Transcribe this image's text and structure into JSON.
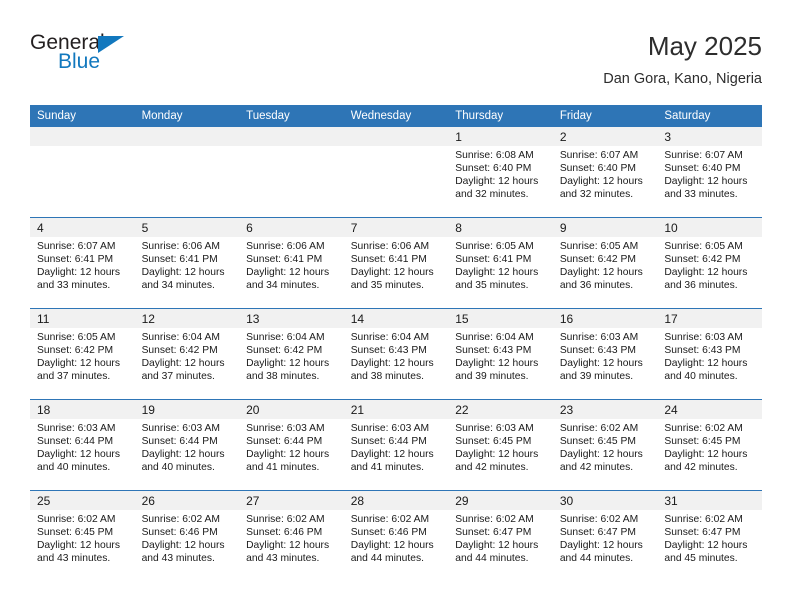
{
  "brand": {
    "name_part1": "General",
    "name_part2": "Blue",
    "triangle_color": "#1278be"
  },
  "header": {
    "title": "May 2025",
    "subtitle": "Dan Gora, Kano, Nigeria"
  },
  "theme": {
    "header_blue": "#2e75b6",
    "daynum_gray": "#f1f1f1",
    "text": "#1a1a1a"
  },
  "weekdays": [
    "Sunday",
    "Monday",
    "Tuesday",
    "Wednesday",
    "Thursday",
    "Friday",
    "Saturday"
  ],
  "weeks": [
    [
      {
        "day": "",
        "lines": []
      },
      {
        "day": "",
        "lines": []
      },
      {
        "day": "",
        "lines": []
      },
      {
        "day": "",
        "lines": []
      },
      {
        "day": "1",
        "lines": [
          "Sunrise: 6:08 AM",
          "Sunset: 6:40 PM",
          "Daylight: 12 hours",
          "and 32 minutes."
        ]
      },
      {
        "day": "2",
        "lines": [
          "Sunrise: 6:07 AM",
          "Sunset: 6:40 PM",
          "Daylight: 12 hours",
          "and 32 minutes."
        ]
      },
      {
        "day": "3",
        "lines": [
          "Sunrise: 6:07 AM",
          "Sunset: 6:40 PM",
          "Daylight: 12 hours",
          "and 33 minutes."
        ]
      }
    ],
    [
      {
        "day": "4",
        "lines": [
          "Sunrise: 6:07 AM",
          "Sunset: 6:41 PM",
          "Daylight: 12 hours",
          "and 33 minutes."
        ]
      },
      {
        "day": "5",
        "lines": [
          "Sunrise: 6:06 AM",
          "Sunset: 6:41 PM",
          "Daylight: 12 hours",
          "and 34 minutes."
        ]
      },
      {
        "day": "6",
        "lines": [
          "Sunrise: 6:06 AM",
          "Sunset: 6:41 PM",
          "Daylight: 12 hours",
          "and 34 minutes."
        ]
      },
      {
        "day": "7",
        "lines": [
          "Sunrise: 6:06 AM",
          "Sunset: 6:41 PM",
          "Daylight: 12 hours",
          "and 35 minutes."
        ]
      },
      {
        "day": "8",
        "lines": [
          "Sunrise: 6:05 AM",
          "Sunset: 6:41 PM",
          "Daylight: 12 hours",
          "and 35 minutes."
        ]
      },
      {
        "day": "9",
        "lines": [
          "Sunrise: 6:05 AM",
          "Sunset: 6:42 PM",
          "Daylight: 12 hours",
          "and 36 minutes."
        ]
      },
      {
        "day": "10",
        "lines": [
          "Sunrise: 6:05 AM",
          "Sunset: 6:42 PM",
          "Daylight: 12 hours",
          "and 36 minutes."
        ]
      }
    ],
    [
      {
        "day": "11",
        "lines": [
          "Sunrise: 6:05 AM",
          "Sunset: 6:42 PM",
          "Daylight: 12 hours",
          "and 37 minutes."
        ]
      },
      {
        "day": "12",
        "lines": [
          "Sunrise: 6:04 AM",
          "Sunset: 6:42 PM",
          "Daylight: 12 hours",
          "and 37 minutes."
        ]
      },
      {
        "day": "13",
        "lines": [
          "Sunrise: 6:04 AM",
          "Sunset: 6:42 PM",
          "Daylight: 12 hours",
          "and 38 minutes."
        ]
      },
      {
        "day": "14",
        "lines": [
          "Sunrise: 6:04 AM",
          "Sunset: 6:43 PM",
          "Daylight: 12 hours",
          "and 38 minutes."
        ]
      },
      {
        "day": "15",
        "lines": [
          "Sunrise: 6:04 AM",
          "Sunset: 6:43 PM",
          "Daylight: 12 hours",
          "and 39 minutes."
        ]
      },
      {
        "day": "16",
        "lines": [
          "Sunrise: 6:03 AM",
          "Sunset: 6:43 PM",
          "Daylight: 12 hours",
          "and 39 minutes."
        ]
      },
      {
        "day": "17",
        "lines": [
          "Sunrise: 6:03 AM",
          "Sunset: 6:43 PM",
          "Daylight: 12 hours",
          "and 40 minutes."
        ]
      }
    ],
    [
      {
        "day": "18",
        "lines": [
          "Sunrise: 6:03 AM",
          "Sunset: 6:44 PM",
          "Daylight: 12 hours",
          "and 40 minutes."
        ]
      },
      {
        "day": "19",
        "lines": [
          "Sunrise: 6:03 AM",
          "Sunset: 6:44 PM",
          "Daylight: 12 hours",
          "and 40 minutes."
        ]
      },
      {
        "day": "20",
        "lines": [
          "Sunrise: 6:03 AM",
          "Sunset: 6:44 PM",
          "Daylight: 12 hours",
          "and 41 minutes."
        ]
      },
      {
        "day": "21",
        "lines": [
          "Sunrise: 6:03 AM",
          "Sunset: 6:44 PM",
          "Daylight: 12 hours",
          "and 41 minutes."
        ]
      },
      {
        "day": "22",
        "lines": [
          "Sunrise: 6:03 AM",
          "Sunset: 6:45 PM",
          "Daylight: 12 hours",
          "and 42 minutes."
        ]
      },
      {
        "day": "23",
        "lines": [
          "Sunrise: 6:02 AM",
          "Sunset: 6:45 PM",
          "Daylight: 12 hours",
          "and 42 minutes."
        ]
      },
      {
        "day": "24",
        "lines": [
          "Sunrise: 6:02 AM",
          "Sunset: 6:45 PM",
          "Daylight: 12 hours",
          "and 42 minutes."
        ]
      }
    ],
    [
      {
        "day": "25",
        "lines": [
          "Sunrise: 6:02 AM",
          "Sunset: 6:45 PM",
          "Daylight: 12 hours",
          "and 43 minutes."
        ]
      },
      {
        "day": "26",
        "lines": [
          "Sunrise: 6:02 AM",
          "Sunset: 6:46 PM",
          "Daylight: 12 hours",
          "and 43 minutes."
        ]
      },
      {
        "day": "27",
        "lines": [
          "Sunrise: 6:02 AM",
          "Sunset: 6:46 PM",
          "Daylight: 12 hours",
          "and 43 minutes."
        ]
      },
      {
        "day": "28",
        "lines": [
          "Sunrise: 6:02 AM",
          "Sunset: 6:46 PM",
          "Daylight: 12 hours",
          "and 44 minutes."
        ]
      },
      {
        "day": "29",
        "lines": [
          "Sunrise: 6:02 AM",
          "Sunset: 6:47 PM",
          "Daylight: 12 hours",
          "and 44 minutes."
        ]
      },
      {
        "day": "30",
        "lines": [
          "Sunrise: 6:02 AM",
          "Sunset: 6:47 PM",
          "Daylight: 12 hours",
          "and 44 minutes."
        ]
      },
      {
        "day": "31",
        "lines": [
          "Sunrise: 6:02 AM",
          "Sunset: 6:47 PM",
          "Daylight: 12 hours",
          "and 45 minutes."
        ]
      }
    ]
  ]
}
